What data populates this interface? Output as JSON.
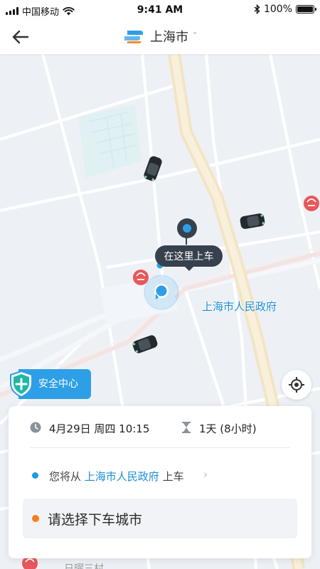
{
  "status_bar": {
    "carrier": "中国移动",
    "time": "9:41 AM",
    "battery": "100%",
    "battery_level": 1.0
  },
  "nav": {
    "city": "上海市",
    "city_chevron": "˅"
  },
  "map": {
    "pickup_tooltip": "在这里上车",
    "place_label": "上海市人民政府",
    "poi_partial": "日曜三村"
  },
  "safety_center": {
    "label": "安全中心"
  },
  "booking": {
    "datetime": "4月29日 周四 10:15",
    "duration": "1天 (8小时)",
    "pickup_prefix": "您将从",
    "pickup_place": "上海市人民政府",
    "pickup_suffix": "上车",
    "pickup_arrow": "›",
    "dropoff_prompt": "请选择下车城市"
  },
  "colors": {
    "accent_blue": "#2e9fe6",
    "place_blue": "#1c8fd6",
    "dropoff_orange": "#ff7a1f",
    "tooltip_dark": "#37414d",
    "metro_red": "#e8585a"
  },
  "icons": {
    "back": "back-arrow-icon",
    "logo": "app-logo-icon",
    "wifi": "wifi-icon",
    "bluetooth": "bluetooth-icon",
    "shield": "shield-plus-icon",
    "locate": "locate-icon",
    "clock": "clock-icon",
    "hourglass": "hourglass-icon",
    "metro": "metro-station-icon",
    "car": "car-icon"
  }
}
